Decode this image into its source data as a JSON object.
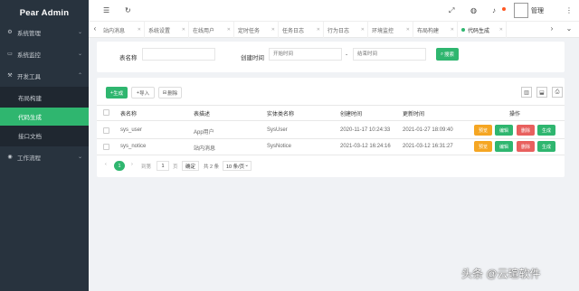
{
  "app": {
    "title": "Pear Admin"
  },
  "sidebar": {
    "items": [
      {
        "label": "系统管理",
        "icon": "gear-icon"
      },
      {
        "label": "系统监控",
        "icon": "monitor-icon"
      },
      {
        "label": "开发工具",
        "icon": "tools-icon"
      }
    ],
    "sub_items": [
      {
        "label": "布局构建"
      },
      {
        "label": "代码生成"
      },
      {
        "label": "接口文档"
      }
    ],
    "bottom_item": {
      "label": "工作流程",
      "icon": "workflow-icon"
    }
  },
  "header": {
    "user_name": "管理"
  },
  "tabs": [
    {
      "label": "站内消息"
    },
    {
      "label": "系统设置"
    },
    {
      "label": "在线用户"
    },
    {
      "label": "定时任务"
    },
    {
      "label": "任务日志"
    },
    {
      "label": "行为日志"
    },
    {
      "label": "环境监控"
    },
    {
      "label": "布局构建"
    },
    {
      "label": "代码生成"
    }
  ],
  "search": {
    "table_name_label": "表名称",
    "table_name_placeholder": "",
    "create_time_label": "创建时间",
    "start_placeholder": "开始时间",
    "separator": "-",
    "end_placeholder": "结束时间",
    "search_button": "搜索"
  },
  "toolbar": {
    "generate_button": "生成",
    "import_button": "导入",
    "delete_button": "删除"
  },
  "table": {
    "headers": [
      "表名称",
      "表描述",
      "实体类名称",
      "创建时间",
      "更新时间",
      "操作"
    ],
    "rows": [
      {
        "name": "sys_user",
        "desc": "App用户",
        "entity": "SysUser",
        "created": "2020-11-17 10:24:33",
        "updated": "2021-01-27 18:09:40"
      },
      {
        "name": "sys_notice",
        "desc": "站内消息",
        "entity": "SysNotice",
        "created": "2021-03-12 16:24:16",
        "updated": "2021-03-12 16:31:27"
      }
    ],
    "actions": [
      "预览",
      "编辑",
      "删除",
      "生成"
    ]
  },
  "pagination": {
    "current_page": "1",
    "goto_label": "到第",
    "page_input": "1",
    "page_suffix": "页",
    "confirm": "确定",
    "total": "共 2 条",
    "page_size": "10 条/页"
  },
  "watermark": "头条 @云瑄软件",
  "colors": {
    "sidebar_bg": "#28333e",
    "accent_green": "#2fb66f",
    "preview_orange": "#f5a623",
    "delete_red": "#e8605e"
  }
}
